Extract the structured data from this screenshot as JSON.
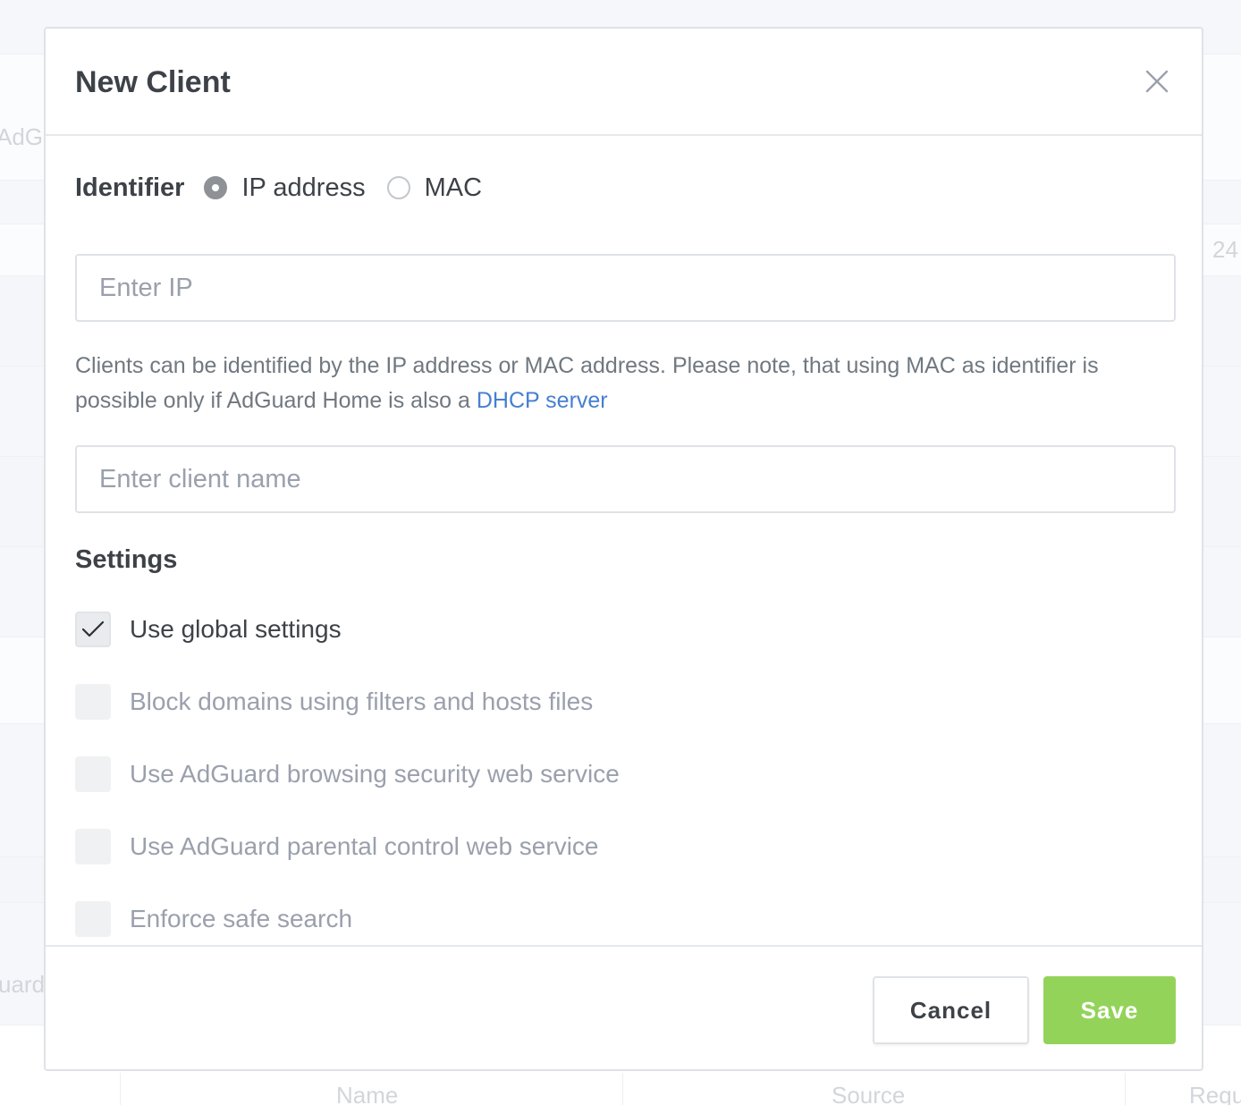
{
  "background": {
    "fragments": [
      {
        "text": "AdG"
      },
      {
        "text": "24"
      },
      {
        "text": "uard"
      },
      {
        "text": "Name"
      },
      {
        "text": "Source"
      },
      {
        "text": "Requ"
      }
    ]
  },
  "modal": {
    "title": "New Client",
    "close_icon": "close-icon",
    "identifier": {
      "label": "Identifier",
      "options": [
        {
          "label": "IP address",
          "checked": true
        },
        {
          "label": "MAC",
          "checked": false
        }
      ]
    },
    "ip_input": {
      "placeholder": "Enter IP",
      "value": ""
    },
    "help": {
      "text": "Clients can be identified by the IP address or MAC address. Please note, that using MAC as identifier is possible only if AdGuard Home is also a ",
      "link_text": "DHCP server"
    },
    "name_input": {
      "placeholder": "Enter client name",
      "value": ""
    },
    "settings": {
      "title": "Settings",
      "items": [
        {
          "label": "Use global settings",
          "checked": true
        },
        {
          "label": "Block domains using filters and hosts files",
          "checked": false
        },
        {
          "label": "Use AdGuard browsing security web service",
          "checked": false
        },
        {
          "label": "Use AdGuard parental control web service",
          "checked": false
        },
        {
          "label": "Enforce safe search",
          "checked": false
        }
      ]
    },
    "footer": {
      "cancel_label": "Cancel",
      "save_label": "Save"
    }
  },
  "colors": {
    "accent_link": "#467fcf",
    "save_button": "#94d35a",
    "title_text": "#3d4248",
    "muted_text": "#9aa0ac"
  }
}
